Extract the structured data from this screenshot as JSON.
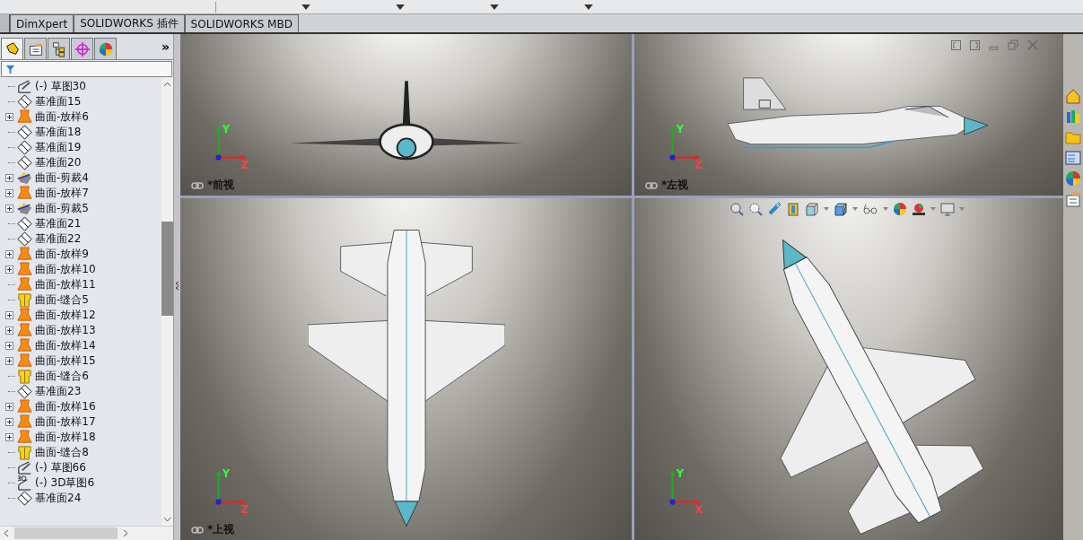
{
  "command_tabs": [
    {
      "label": "DimXpert",
      "selected": false
    },
    {
      "label": "SOLIDWORKS 插件",
      "selected": false
    },
    {
      "label": "SOLIDWORKS MBD",
      "selected": false
    }
  ],
  "panel_tabs": [
    {
      "kind": "feature",
      "selected": true
    },
    {
      "kind": "property",
      "selected": false
    },
    {
      "kind": "config",
      "selected": false
    },
    {
      "kind": "dimxpert",
      "selected": false
    },
    {
      "kind": "display",
      "selected": false
    }
  ],
  "panel_more": "»",
  "tree": [
    {
      "label": "(-) 草图30",
      "kind": "sketch",
      "collapsed": false
    },
    {
      "label": "基准面15",
      "kind": "plane",
      "collapsed": false
    },
    {
      "label": "曲面-放样6",
      "kind": "loft",
      "collapsed": true
    },
    {
      "label": "基准面18",
      "kind": "plane",
      "collapsed": false
    },
    {
      "label": "基准面19",
      "kind": "plane",
      "collapsed": false
    },
    {
      "label": "基准面20",
      "kind": "plane",
      "collapsed": false
    },
    {
      "label": "曲面-剪裁4",
      "kind": "trim",
      "collapsed": true
    },
    {
      "label": "曲面-放样7",
      "kind": "loft",
      "collapsed": true
    },
    {
      "label": "曲面-剪裁5",
      "kind": "trim",
      "collapsed": true
    },
    {
      "label": "基准面21",
      "kind": "plane",
      "collapsed": false
    },
    {
      "label": "基准面22",
      "kind": "plane",
      "collapsed": false
    },
    {
      "label": "曲面-放样9",
      "kind": "loft",
      "collapsed": true
    },
    {
      "label": "曲面-放样10",
      "kind": "loft",
      "collapsed": true
    },
    {
      "label": "曲面-放样11",
      "kind": "loft",
      "collapsed": false
    },
    {
      "label": "曲面-缝合5",
      "kind": "knit",
      "collapsed": false
    },
    {
      "label": "曲面-放样12",
      "kind": "loft",
      "collapsed": true
    },
    {
      "label": "曲面-放样13",
      "kind": "loft",
      "collapsed": true
    },
    {
      "label": "曲面-放样14",
      "kind": "loft",
      "collapsed": true
    },
    {
      "label": "曲面-放样15",
      "kind": "loft",
      "collapsed": true
    },
    {
      "label": "曲面-缝合6",
      "kind": "knit",
      "collapsed": false
    },
    {
      "label": "基准面23",
      "kind": "plane",
      "collapsed": false
    },
    {
      "label": "曲面-放样16",
      "kind": "loft",
      "collapsed": true
    },
    {
      "label": "曲面-放样17",
      "kind": "loft",
      "collapsed": true
    },
    {
      "label": "曲面-放样18",
      "kind": "loft",
      "collapsed": true
    },
    {
      "label": "曲面-缝合8",
      "kind": "knit",
      "collapsed": false
    },
    {
      "label": "(-) 草图66",
      "kind": "sketch",
      "collapsed": false
    },
    {
      "label": "(-) 3D草图6",
      "kind": "sketch3d",
      "collapsed": false
    },
    {
      "label": "基准面24",
      "kind": "plane",
      "collapsed": false
    }
  ],
  "viewports": [
    {
      "kind": "front",
      "label": "*前视",
      "triad": [
        "Y",
        "Z"
      ]
    },
    {
      "kind": "left",
      "label": "*左视",
      "triad": [
        "Y",
        "Z"
      ]
    },
    {
      "kind": "top",
      "label": "*上视",
      "triad": [
        "Y",
        "Z"
      ]
    },
    {
      "kind": "iso",
      "triad": [
        "Y",
        "X"
      ]
    }
  ]
}
